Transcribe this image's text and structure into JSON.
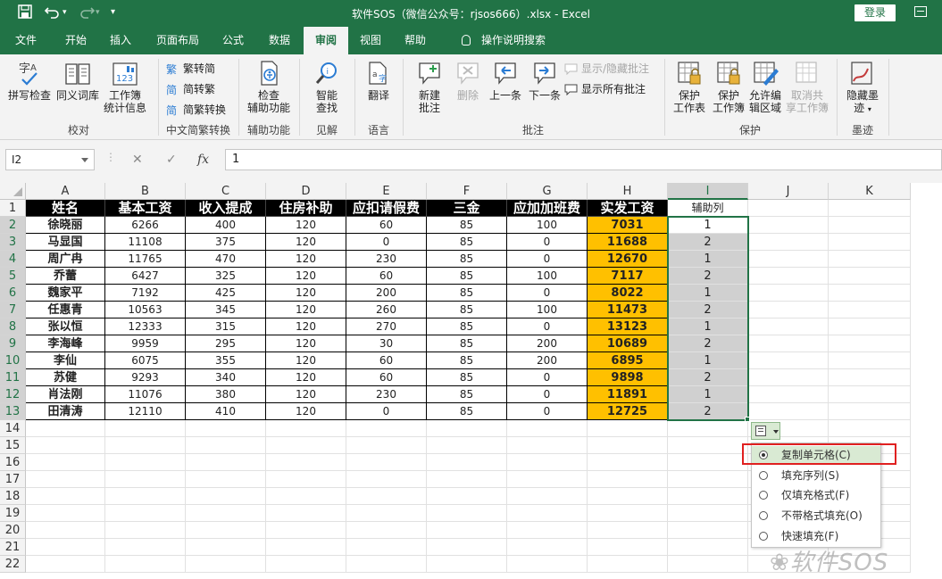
{
  "title": {
    "text": "软件SOS（微信公众号：rjsos666）.xlsx  -  Excel",
    "login_label": "登录"
  },
  "tabs": [
    "文件",
    "开始",
    "插入",
    "页面布局",
    "公式",
    "数据",
    "审阅",
    "视图",
    "帮助",
    "操作说明搜索"
  ],
  "active_tab": "审阅",
  "ribbon": {
    "spelling": "拼写检查",
    "thesaurus": "同义词库",
    "workbook_stats_1": "工作簿",
    "workbook_stats_2": "统计信息",
    "group_proofing": "校对",
    "to_simplified": "繁转简",
    "to_traditional": "简转繁",
    "convert": "简繁转换",
    "group_chinese": "中文简繁转换",
    "accessibility_1": "检查",
    "accessibility_2": "辅助功能",
    "group_accessibility": "辅助功能",
    "smart_lookup_1": "智能",
    "smart_lookup_2": "查找",
    "group_insights": "见解",
    "translate": "翻译",
    "group_language": "语言",
    "new_comment_1": "新建",
    "new_comment_2": "批注",
    "delete": "删除",
    "previous": "上一条",
    "next": "下一条",
    "show_hide_comment": "显示/隐藏批注",
    "show_all_comments": "显示所有批注",
    "group_comments": "批注",
    "protect_sheet_1": "保护",
    "protect_sheet_2": "工作表",
    "protect_workbook_1": "保护",
    "protect_workbook_2": "工作簿",
    "allow_edit_1": "允许编",
    "allow_edit_2": "辑区域",
    "unshare_1": "取消共",
    "unshare_2": "享工作簿",
    "group_protect": "保护",
    "hide_ink_1": "隐藏墨",
    "hide_ink_2": "迹",
    "group_ink": "墨迹"
  },
  "formula_bar": {
    "name_box": "I2",
    "value": "1"
  },
  "columns": [
    "A",
    "B",
    "C",
    "D",
    "E",
    "F",
    "G",
    "H",
    "I",
    "J",
    "K"
  ],
  "rows": [
    "1",
    "2",
    "3",
    "4",
    "5",
    "6",
    "7",
    "8",
    "9",
    "10",
    "11",
    "12",
    "13",
    "14",
    "15",
    "16",
    "17",
    "18",
    "19",
    "20",
    "21",
    "22"
  ],
  "headers": [
    "姓名",
    "基本工资",
    "收入提成",
    "住房补助",
    "应扣请假费",
    "三金",
    "应加加班费",
    "实发工资",
    "辅助列"
  ],
  "data_rows": [
    [
      "徐晓丽",
      "6266",
      "400",
      "120",
      "60",
      "85",
      "100",
      "7031",
      "1"
    ],
    [
      "马显国",
      "11108",
      "375",
      "120",
      "0",
      "85",
      "0",
      "11688",
      "2"
    ],
    [
      "周广冉",
      "11765",
      "470",
      "120",
      "230",
      "85",
      "0",
      "12670",
      "1"
    ],
    [
      "乔蕾",
      "6427",
      "325",
      "120",
      "60",
      "85",
      "100",
      "7117",
      "2"
    ],
    [
      "魏家平",
      "7192",
      "425",
      "120",
      "200",
      "85",
      "0",
      "8022",
      "1"
    ],
    [
      "任惠青",
      "10563",
      "345",
      "120",
      "260",
      "85",
      "100",
      "11473",
      "2"
    ],
    [
      "张以恒",
      "12333",
      "315",
      "120",
      "270",
      "85",
      "0",
      "13123",
      "1"
    ],
    [
      "李海峰",
      "9959",
      "295",
      "120",
      "30",
      "85",
      "200",
      "10689",
      "2"
    ],
    [
      "李仙",
      "6075",
      "355",
      "120",
      "60",
      "85",
      "200",
      "6895",
      "1"
    ],
    [
      "苏健",
      "9293",
      "340",
      "120",
      "60",
      "85",
      "0",
      "9898",
      "2"
    ],
    [
      "肖法刚",
      "11076",
      "380",
      "120",
      "230",
      "85",
      "0",
      "11891",
      "1"
    ],
    [
      "田清涛",
      "12110",
      "410",
      "120",
      "0",
      "85",
      "0",
      "12725",
      "2"
    ]
  ],
  "fill_menu": [
    {
      "label": "复制单元格(C)",
      "selected": true
    },
    {
      "label": "填充序列(S)",
      "selected": false
    },
    {
      "label": "仅填充格式(F)",
      "selected": false
    },
    {
      "label": "不带格式填充(O)",
      "selected": false
    },
    {
      "label": "快速填充(F)",
      "selected": false
    }
  ],
  "watermark": "软件SOS",
  "colors": {
    "excel_green": "#217346",
    "pay_highlight": "#ffc000",
    "aux_fill": "#d0d0d0",
    "callout_red": "#e02020"
  }
}
